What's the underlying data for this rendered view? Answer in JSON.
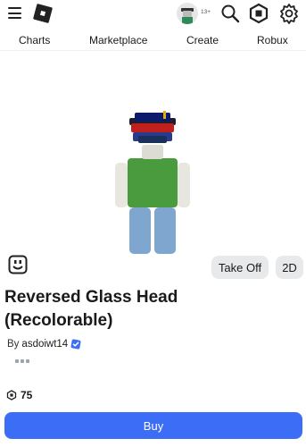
{
  "header": {
    "age_badge": "13+",
    "icons": [
      "menu-icon",
      "roblox-logo",
      "avatar",
      "search-icon",
      "robux-icon",
      "gear-icon"
    ]
  },
  "nav": {
    "items": [
      "Charts",
      "Marketplace",
      "Create",
      "Robux"
    ]
  },
  "preview": {
    "take_off_label": "Take Off",
    "view_2d_label": "2D",
    "emote_icon": "emote-icon"
  },
  "item": {
    "title_line1": "Reversed Glass Head",
    "title_line2": "(Recolorable)",
    "by_prefix": "By",
    "creator": "asdoiwt14",
    "creator_verified": true,
    "price": "75"
  },
  "actions": {
    "buy_label": "Buy"
  },
  "colors": {
    "accent": "#3b6df6",
    "button_gray": "#e8e9eb",
    "verified_blue": "#3b6df6"
  }
}
